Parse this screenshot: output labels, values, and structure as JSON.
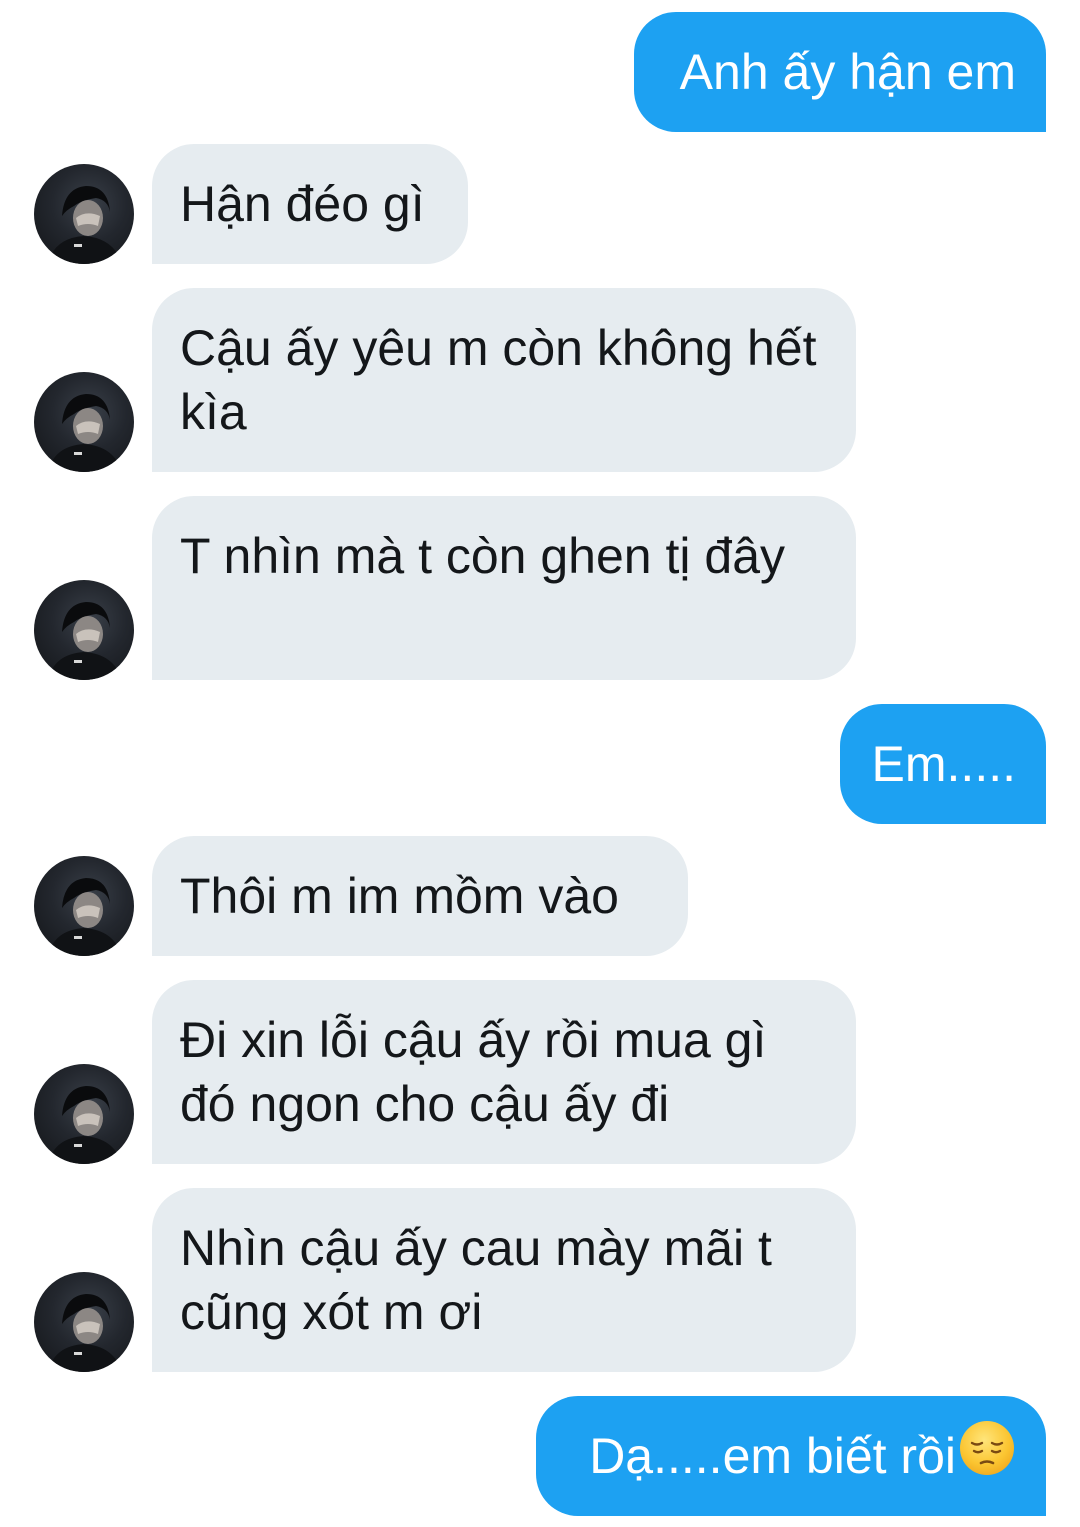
{
  "conversation": {
    "messages": [
      {
        "sender": "me",
        "text": "Anh ấy hận em"
      },
      {
        "sender": "friend",
        "text": "Hận đéo gì"
      },
      {
        "sender": "friend",
        "text": "Cậu ấy yêu m còn không hết kìa"
      },
      {
        "sender": "friend",
        "text": "T nhìn mà t còn ghen tị đây"
      },
      {
        "sender": "me",
        "text": "Em....."
      },
      {
        "sender": "friend",
        "text": "Thôi m im mồm vào"
      },
      {
        "sender": "friend",
        "text": "Đi xin lỗi cậu ấy rồi mua gì đó ngon cho cậu ấy đi"
      },
      {
        "sender": "friend",
        "text": "Nhìn cậu ấy cau mày mãi t cũng xót m ơi"
      },
      {
        "sender": "me",
        "text": "Dạ.....em biết rồi",
        "emoji": "pensive-face"
      }
    ]
  },
  "colors": {
    "outgoing_bubble": "#1da1f2",
    "incoming_bubble": "#e6ecf0",
    "outgoing_text": "#ffffff",
    "incoming_text": "#14171a",
    "background": "#ffffff"
  },
  "icons": {
    "avatar": "user-avatar-photo",
    "emoji": "pensive-face-emoji"
  }
}
